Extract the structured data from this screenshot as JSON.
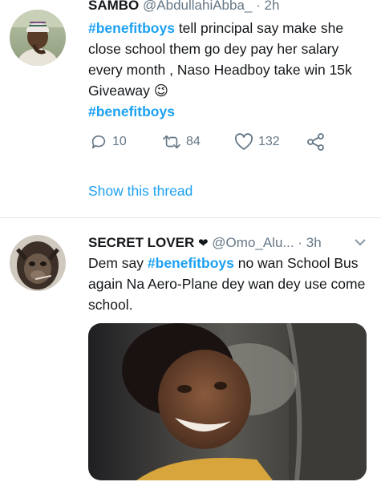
{
  "tweets": [
    {
      "display_name": "SAMBO",
      "handle": "@AbdullahiAbba_",
      "dot": "·",
      "time": "2h",
      "text_parts": [
        {
          "type": "hashtag",
          "text": "#benefitboys"
        },
        {
          "type": "text",
          "text": " tell principal say make she close school them go dey pay her salary every month ,  Naso Headboy take win 15k Giveaway "
        },
        {
          "type": "emoji",
          "text": "😉"
        },
        {
          "type": "break",
          "text": ""
        },
        {
          "type": "hashtag",
          "text": "#benefitboys"
        }
      ],
      "reply_count": "10",
      "retweet_count": "84",
      "like_count": "132",
      "show_thread": "Show this thread"
    },
    {
      "display_name": "SECRET LOVER",
      "name_emoji": "❤",
      "handle": "@Omo_Alu...",
      "dot": "·",
      "time": "3h",
      "text_parts": [
        {
          "type": "text",
          "text": "Dem say "
        },
        {
          "type": "hashtag",
          "text": "#benefitboys"
        },
        {
          "type": "text",
          "text": " no wan School Bus again Na Aero-Plane dey wan dey use come school."
        }
      ]
    }
  ],
  "icons": {
    "reply": "reply-icon",
    "retweet": "retweet-icon",
    "like": "heart-icon",
    "share": "share-icon",
    "more": "chevron-down-icon"
  },
  "colors": {
    "accent": "#1da1f2",
    "secondary_text": "#657786",
    "divider": "#e1e8ed"
  }
}
